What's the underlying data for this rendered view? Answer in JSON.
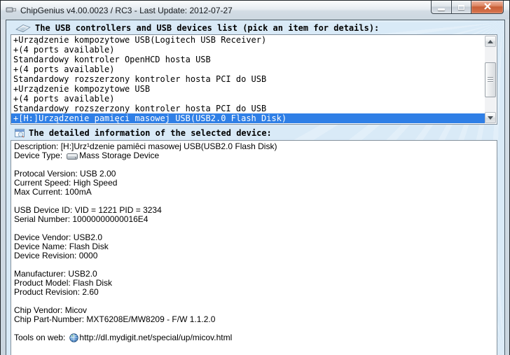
{
  "window": {
    "title": "ChipGenius v4.00.0023 / RC3 - Last Update: 2012-07-27",
    "controls": {
      "minimize": "minimize",
      "maximize": "maximize",
      "close": "close"
    }
  },
  "list": {
    "header": "The USB controllers and USB devices list (pick an item for details):",
    "selected_index": 8,
    "items": [
      "+Urządzenie kompozytowe USB(Logitech USB Receiver)",
      "+(4 ports available)",
      "Standardowy kontroler OpenHCD hosta USB",
      "+(4 ports available)",
      "Standardowy rozszerzony kontroler hosta PCI do USB",
      "+Urządzenie kompozytowe USB",
      "+(4 ports available)",
      "Standardowy rozszerzony kontroler hosta PCI do USB",
      "+[H:]Urządzenie pamięci masowej USB(USB2.0 Flash Disk)"
    ]
  },
  "details": {
    "header": "The detailed information of the selected device:",
    "lines": [
      "Description: [H:]Urz¹dzenie pamiêci masowej USB(USB2.0 Flash Disk)",
      {
        "label": "Device Type:",
        "icon": "drive-icon",
        "value": "Mass Storage Device"
      },
      "",
      "Protocal Version: USB 2.00",
      "Current Speed: High Speed",
      "Max Current: 100mA",
      "",
      "USB Device ID: VID = 1221 PID = 3234",
      "Serial Number: 10000000000016E4",
      "",
      "Device Vendor: USB2.0",
      "Device Name: Flash Disk",
      "Device Revision: 0000",
      "",
      "Manufacturer: USB2.0",
      "Product Model: Flash Disk",
      "Product Revision: 2.60",
      "",
      "Chip Vendor: Micov",
      "Chip Part-Number: MXT6208E/MW8209 - F/W 1.1.2.0",
      "",
      {
        "label": "Tools on web:",
        "icon": "globe-icon",
        "value": "http://dl.mydigit.net/special/up/micov.html"
      }
    ]
  },
  "icons": {
    "titlebar": "usb-stick-icon",
    "list_header": "usb-plug-icon",
    "detail_header": "window-search-icon",
    "device_type": "drive-icon",
    "tools": "globe-icon",
    "scrollbar": [
      "arrow-up-icon",
      "arrow-down-icon"
    ]
  },
  "colors": {
    "selection_blue": "#2f7fe6",
    "client_background": "#d9eaf7",
    "close_red": "#c85f37"
  }
}
